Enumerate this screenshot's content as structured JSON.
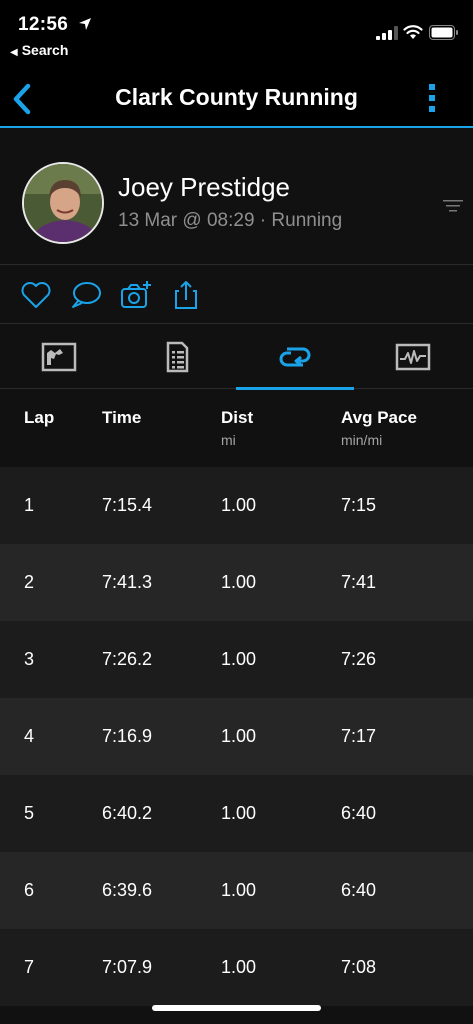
{
  "status_bar": {
    "time": "12:56",
    "back_label": "Search"
  },
  "nav": {
    "title": "Clark County Running"
  },
  "profile": {
    "name": "Joey Prestidge",
    "subtitle": "13 Mar @ 08:29 · Running"
  },
  "actions": [
    {
      "icon": "heart-icon"
    },
    {
      "icon": "comment-icon"
    },
    {
      "icon": "camera-add-icon"
    },
    {
      "icon": "share-icon"
    }
  ],
  "tabs": [
    {
      "icon": "map-icon",
      "active": false
    },
    {
      "icon": "details-icon",
      "active": false
    },
    {
      "icon": "laps-icon",
      "active": true
    },
    {
      "icon": "chart-icon",
      "active": false
    }
  ],
  "colors": {
    "accent": "#1aa3e8",
    "row_dark": "#1c1c1c",
    "row_light": "#262626"
  },
  "table": {
    "headers": {
      "lap": "Lap",
      "time": "Time",
      "dist": "Dist",
      "dist_unit": "mi",
      "pace": "Avg Pace",
      "pace_unit": "min/mi"
    },
    "rows": [
      {
        "lap": "1",
        "time": "7:15.4",
        "dist": "1.00",
        "pace": "7:15"
      },
      {
        "lap": "2",
        "time": "7:41.3",
        "dist": "1.00",
        "pace": "7:41"
      },
      {
        "lap": "3",
        "time": "7:26.2",
        "dist": "1.00",
        "pace": "7:26"
      },
      {
        "lap": "4",
        "time": "7:16.9",
        "dist": "1.00",
        "pace": "7:17"
      },
      {
        "lap": "5",
        "time": "6:40.2",
        "dist": "1.00",
        "pace": "6:40"
      },
      {
        "lap": "6",
        "time": "6:39.6",
        "dist": "1.00",
        "pace": "6:40"
      },
      {
        "lap": "7",
        "time": "7:07.9",
        "dist": "1.00",
        "pace": "7:08"
      }
    ]
  }
}
